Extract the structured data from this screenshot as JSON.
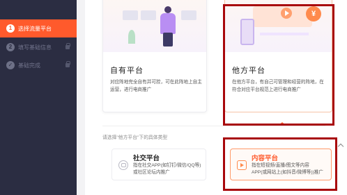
{
  "sidebar": {
    "steps": [
      {
        "num": "1",
        "label": "选择流量平台",
        "state": "active"
      },
      {
        "num": "2",
        "label": "填写基础信息",
        "state": "locked"
      },
      {
        "num": "✓",
        "label": "基础完成",
        "state": "locked"
      }
    ]
  },
  "platforms": {
    "own": {
      "title": "自有平台",
      "desc": "对应阵地完全自有并可控，可在此阵地上自主运营，进行电商推广"
    },
    "other": {
      "title": "他方平台",
      "desc": "在他方平台，有自己可管理和经营的阵地，在符合对应平台规范上进行电商推广",
      "badge": "¥"
    }
  },
  "prompt": "请选择\"他方平台\"下的具体类型",
  "types": {
    "social": {
      "title": "社交平台",
      "desc": "指在社交APP(如钉钉/微信/QQ等)或社区论坛内推广"
    },
    "content": {
      "title": "内容平台",
      "desc": "指在短视频/直播/图文等内容APP(或网站上(如抖音/微博等))推广"
    }
  },
  "colors": {
    "sidebar_bg": "#2b2d42",
    "accent": "#ff5a2c",
    "highlight": "#a8070b"
  }
}
